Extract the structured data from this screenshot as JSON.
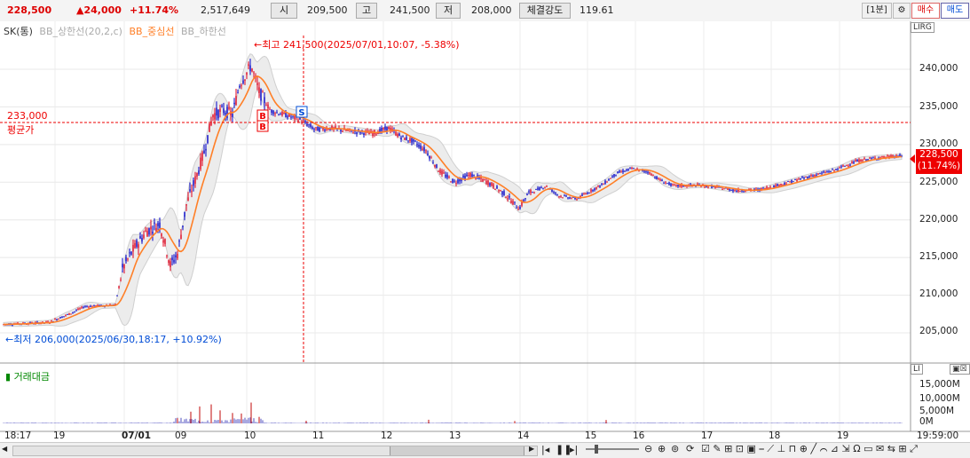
{
  "header": {
    "price": "228,500",
    "change": "▲24,000",
    "change_pct": "+11.74%",
    "volume": "2,517,649",
    "open_label": "시",
    "open_value": "209,500",
    "high_label": "고",
    "high_value": "241,500",
    "low_label": "저",
    "low_value": "208,000",
    "strength_label": "체결강도",
    "strength_value": "119.61",
    "interval": "[1분]",
    "buy_label": "매수",
    "sell_label": "매도"
  },
  "legend": {
    "symbol": "SK(통)",
    "bb_upper": "BB_상한선(20,2,c)",
    "bb_middle": "BB_중심선",
    "bb_lower": "BB_하한선"
  },
  "annotations": {
    "high": "←최고 241,500(2025/07/01,10:07, -5.38%)",
    "low": "←최저 206,000(2025/06/30,18:17, +10.92%)",
    "avg_value": "233,000",
    "avg_label": "평균가",
    "last_price": "228,500",
    "last_pct": "(11.74%)",
    "buy_marker": "B",
    "sell_marker": "S"
  },
  "price_axis": [
    "240,000",
    "235,000",
    "230,000",
    "225,000",
    "220,000",
    "215,000",
    "210,000",
    "205,000"
  ],
  "volume_panel": {
    "title": "거래대금",
    "axis": [
      "15,000M",
      "10,000M",
      "5,000M",
      "0M"
    ]
  },
  "time_axis": [
    "18:17",
    "19",
    "07/01",
    "09",
    "10",
    "11",
    "12",
    "13",
    "14",
    "15",
    "16",
    "17",
    "18",
    "19",
    "19:59:00"
  ],
  "chart_data": {
    "type": "candlestick",
    "price_range": [
      202500,
      244000
    ],
    "volume_range_M": [
      0,
      18000
    ],
    "avg_price": 233000,
    "high_point": {
      "value": 241500,
      "time": "2025/07/01 10:07"
    },
    "low_point": {
      "value": 206000,
      "time": "2025/06/30 18:17"
    },
    "trajectory": [
      [
        0,
        206100
      ],
      [
        55,
        206400
      ],
      [
        80,
        207600
      ],
      [
        95,
        208500
      ],
      [
        130,
        208700
      ],
      [
        138,
        213500
      ],
      [
        150,
        216000
      ],
      [
        165,
        218500
      ],
      [
        180,
        219500
      ],
      [
        192,
        214000
      ],
      [
        200,
        215500
      ],
      [
        210,
        222000
      ],
      [
        222,
        226000
      ],
      [
        230,
        229000
      ],
      [
        240,
        234000
      ],
      [
        252,
        234500
      ],
      [
        262,
        234000
      ],
      [
        270,
        238000
      ],
      [
        283,
        240500
      ],
      [
        292,
        237000
      ],
      [
        305,
        234500
      ],
      [
        325,
        233800
      ],
      [
        340,
        233200
      ],
      [
        355,
        232000
      ],
      [
        370,
        232200
      ],
      [
        395,
        231800
      ],
      [
        420,
        231500
      ],
      [
        438,
        232200
      ],
      [
        452,
        231000
      ],
      [
        465,
        230500
      ],
      [
        480,
        229200
      ],
      [
        495,
        226500
      ],
      [
        512,
        225000
      ],
      [
        530,
        226000
      ],
      [
        550,
        225000
      ],
      [
        568,
        223500
      ],
      [
        585,
        221500
      ],
      [
        595,
        223500
      ],
      [
        615,
        224500
      ],
      [
        630,
        223200
      ],
      [
        650,
        222800
      ],
      [
        665,
        223800
      ],
      [
        680,
        224800
      ],
      [
        695,
        226200
      ],
      [
        712,
        226800
      ],
      [
        730,
        226400
      ],
      [
        745,
        225200
      ],
      [
        760,
        224500
      ],
      [
        790,
        224600
      ],
      [
        815,
        224200
      ],
      [
        830,
        223900
      ],
      [
        855,
        224000
      ],
      [
        880,
        224700
      ],
      [
        910,
        225700
      ],
      [
        940,
        226600
      ],
      [
        965,
        227800
      ],
      [
        985,
        228200
      ],
      [
        1017,
        228500
      ]
    ],
    "volume_spikes": [
      [
        200,
        2000
      ],
      [
        215,
        4500
      ],
      [
        225,
        6500
      ],
      [
        238,
        7300
      ],
      [
        248,
        5000
      ],
      [
        262,
        4000
      ],
      [
        272,
        3800
      ],
      [
        283,
        8000
      ],
      [
        292,
        2500
      ],
      [
        345,
        1000
      ],
      [
        483,
        1400
      ],
      [
        580,
        900
      ],
      [
        683,
        1300
      ]
    ]
  },
  "colors": {
    "up": "#e0001b",
    "down": "#0000c8",
    "bb_middle": "#ff7f27",
    "bb_band": "#cfcfcf",
    "avg_line": "#e00000",
    "volume": "#d04040"
  },
  "icons": {
    "gear": "gear-icon",
    "first": "skip-first-icon",
    "pause": "pause-icon",
    "play": "play-icon"
  }
}
